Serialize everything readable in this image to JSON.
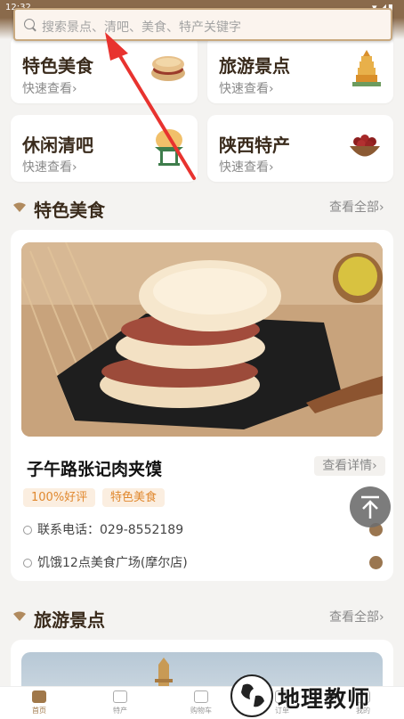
{
  "status_bar": {
    "time": "12:32",
    "icons": "▾◢▮"
  },
  "search": {
    "placeholder": "搜索景点、清吧、美食、特产关键字"
  },
  "categories": [
    {
      "title": "特色美食",
      "sub": "快速查看›"
    },
    {
      "title": "旅游景点",
      "sub": "快速查看›"
    },
    {
      "title": "休闲清吧",
      "sub": "快速查看›"
    },
    {
      "title": "陕西特产",
      "sub": "快速查看›"
    }
  ],
  "sections": {
    "food": {
      "title": "特色美食",
      "see_all": "查看全部›"
    },
    "travel": {
      "title": "旅游景点",
      "see_all": "查看全部›"
    }
  },
  "food_item": {
    "name": "子午路张记肉夹馍",
    "detail_label": "查看详情›",
    "tags": [
      "100%好评",
      "特色美食"
    ],
    "phone": "联系电话：029-8552189",
    "address": "饥饿12点美食广场(摩尔店)"
  },
  "bottom_nav": [
    {
      "label": "首页",
      "active": true
    },
    {
      "label": "特产",
      "active": false
    },
    {
      "label": "购物车",
      "active": false
    },
    {
      "label": "订单",
      "active": false
    },
    {
      "label": "我的",
      "active": false
    }
  ],
  "watermark": {
    "text": "地理教师"
  },
  "colors": {
    "brand": "#8a6a4b",
    "accent_tag": "#e0882e",
    "annotation": "#e8332f"
  }
}
